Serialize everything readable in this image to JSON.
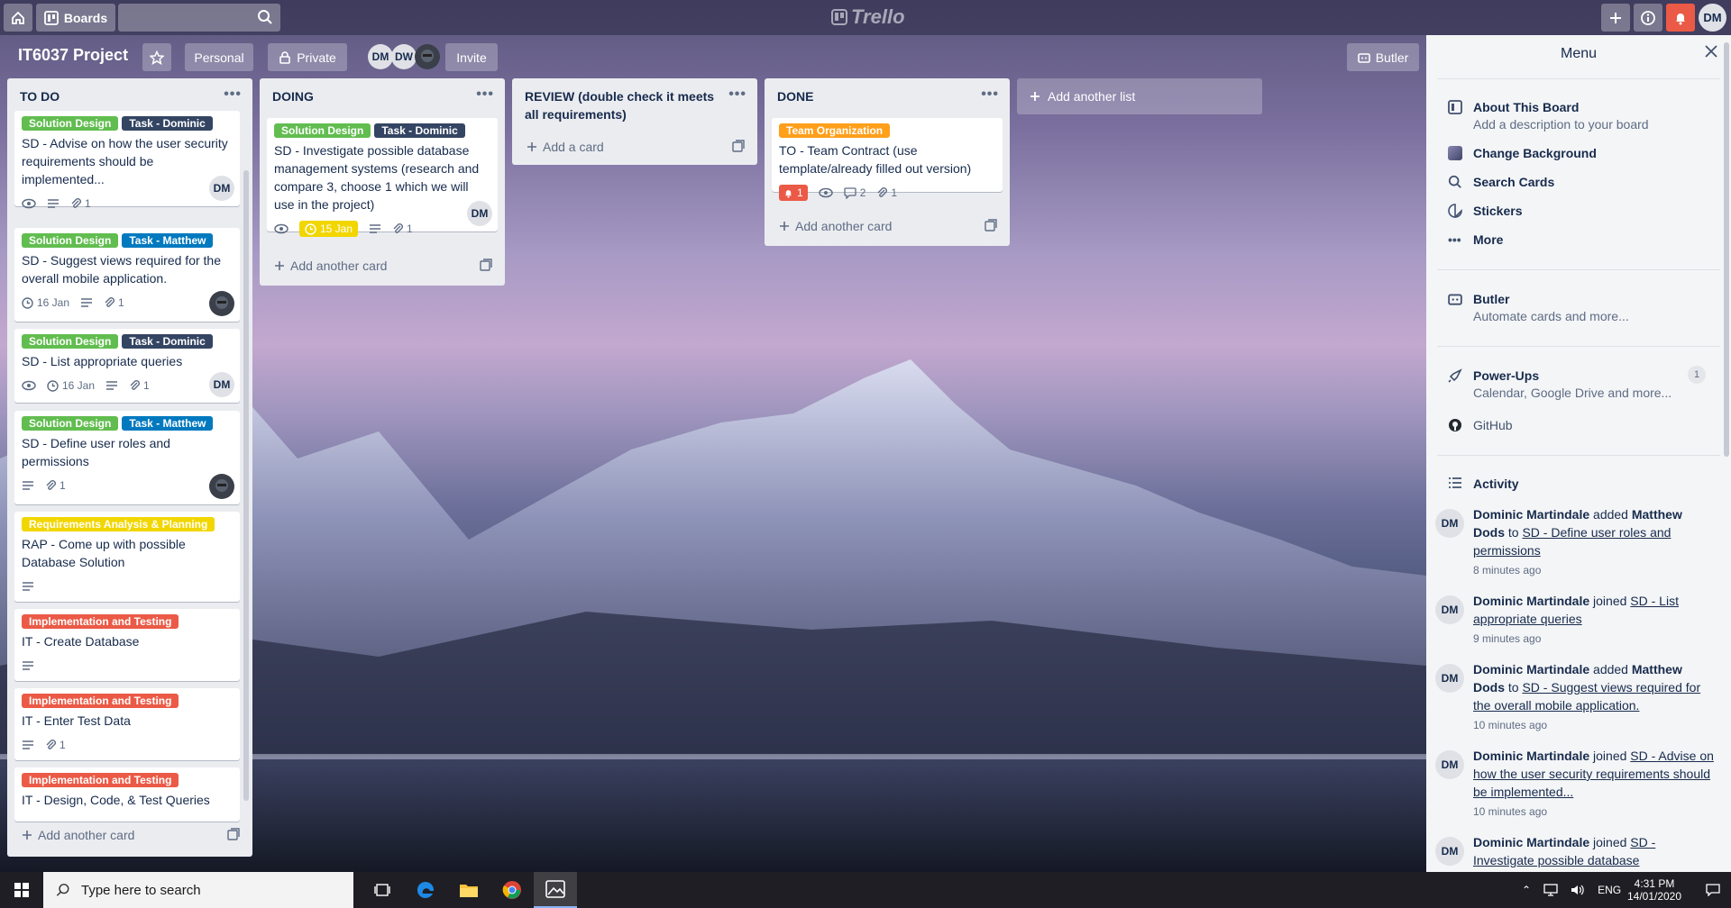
{
  "topbar": {
    "boards_label": "Boards",
    "logo": "Trello",
    "user_initials": "DM",
    "icons": [
      "home-icon",
      "boards-icon",
      "search-icon",
      "plus-icon",
      "info-icon",
      "bell-icon"
    ]
  },
  "board": {
    "title": "IT6037 Project",
    "personal": "Personal",
    "private": "Private",
    "invite": "Invite",
    "butler": "Butler",
    "members": [
      "DM",
      "DW"
    ]
  },
  "lists": [
    {
      "title": "TO DO",
      "add": "Add another card",
      "cards": [
        {
          "labels": [
            {
              "text": "Solution Design",
              "color": "#61bd4f"
            },
            {
              "text": "Task - Dominic",
              "color": "#344563"
            }
          ],
          "title": "SD - Advise on how the user security requirements should be implemented...",
          "badges": {
            "eye": true,
            "desc": true,
            "attach": "1"
          },
          "member": "DM"
        },
        {
          "labels": [
            {
              "text": "Solution Design",
              "color": "#61bd4f"
            },
            {
              "text": "Task - Matthew",
              "color": "#0079bf"
            }
          ],
          "title": "SD - Suggest views required for the overall mobile application.",
          "badges": {
            "due": "16 Jan",
            "desc": true,
            "attach": "1"
          },
          "member": "img"
        },
        {
          "labels": [
            {
              "text": "Solution Design",
              "color": "#61bd4f"
            },
            {
              "text": "Task - Dominic",
              "color": "#344563"
            }
          ],
          "title": "SD - List appropriate queries",
          "badges": {
            "eye": true,
            "due": "16 Jan",
            "desc": true,
            "attach": "1"
          },
          "member": "DM"
        },
        {
          "labels": [
            {
              "text": "Solution Design",
              "color": "#61bd4f"
            },
            {
              "text": "Task - Matthew",
              "color": "#0079bf"
            }
          ],
          "title": "SD - Define user roles and permissions",
          "badges": {
            "desc": true,
            "attach": "1"
          },
          "member": "img"
        },
        {
          "labels": [
            {
              "text": "Requirements Analysis & Planning",
              "color": "#f2d600"
            }
          ],
          "title": "RAP - Come up with possible Database Solution",
          "badges": {
            "desc": true
          }
        },
        {
          "labels": [
            {
              "text": "Implementation and Testing",
              "color": "#eb5a46"
            }
          ],
          "title": "IT - Create Database",
          "badges": {
            "desc": true
          }
        },
        {
          "labels": [
            {
              "text": "Implementation and Testing",
              "color": "#eb5a46"
            }
          ],
          "title": "IT - Enter Test Data",
          "badges": {
            "desc": true,
            "attach": "1"
          }
        },
        {
          "labels": [
            {
              "text": "Implementation and Testing",
              "color": "#eb5a46"
            }
          ],
          "title": "IT - Design, Code, & Test Queries",
          "badges": {
            "desc": true
          }
        }
      ]
    },
    {
      "title": "DOING",
      "add": "Add another card",
      "cards": [
        {
          "labels": [
            {
              "text": "Solution Design",
              "color": "#61bd4f"
            },
            {
              "text": "Task - Dominic",
              "color": "#344563"
            }
          ],
          "title": "SD - Investigate possible database management systems (research and compare 3, choose 1 which we will use in the project)",
          "badges": {
            "eye": true,
            "due_yellow": "15 Jan",
            "desc": true,
            "attach": "1"
          },
          "member": "DM"
        }
      ]
    },
    {
      "title": "REVIEW (double check it meets all requirements)",
      "add": "Add a card",
      "cards": []
    },
    {
      "title": "DONE",
      "add": "Add another card",
      "cards": [
        {
          "labels": [
            {
              "text": "Team Organization",
              "color": "#ff9f1a"
            }
          ],
          "title": "TO - Team Contract (use template/already filled out version)",
          "badges": {
            "alert": "1",
            "eye": true,
            "comments": "2",
            "attach": "1"
          }
        }
      ]
    }
  ],
  "add_list": "Add another list",
  "menu": {
    "title": "Menu",
    "items": [
      {
        "title": "About This Board",
        "sub": "Add a description to your board"
      },
      {
        "title": "Change Background"
      },
      {
        "title": "Search Cards"
      },
      {
        "title": "Stickers"
      },
      {
        "title": "More"
      },
      {
        "title": "Butler",
        "sub": "Automate cards and more..."
      },
      {
        "title": "Power-Ups",
        "sub": "Calendar, Google Drive and more...",
        "count": "1"
      },
      {
        "title": "GitHub"
      }
    ],
    "activity_title": "Activity",
    "activity": [
      {
        "who": "Dominic Martindale",
        "action": " added ",
        "target": "Matthew Dods",
        "mid": " to ",
        "link": "SD - Define user roles and permissions",
        "time": "8 minutes ago"
      },
      {
        "who": "Dominic Martindale",
        "action": " joined ",
        "target": "",
        "mid": "",
        "link": "SD - List appropriate queries",
        "time": "9 minutes ago"
      },
      {
        "who": "Dominic Martindale",
        "action": " added ",
        "target": "Matthew Dods",
        "mid": " to ",
        "link": "SD - Suggest views required for the overall mobile application.",
        "time": "10 minutes ago"
      },
      {
        "who": "Dominic Martindale",
        "action": " joined ",
        "target": "",
        "mid": "",
        "link": "SD - Advise on how the user security requirements should be implemented...",
        "time": "10 minutes ago"
      },
      {
        "who": "Dominic Martindale",
        "action": " joined ",
        "target": "",
        "mid": "",
        "link": "SD - Investigate possible database management",
        "time": ""
      }
    ]
  },
  "taskbar": {
    "search_placeholder": "Type here to search",
    "lang": "ENG",
    "time": "4:31 PM",
    "date": "14/01/2020"
  }
}
